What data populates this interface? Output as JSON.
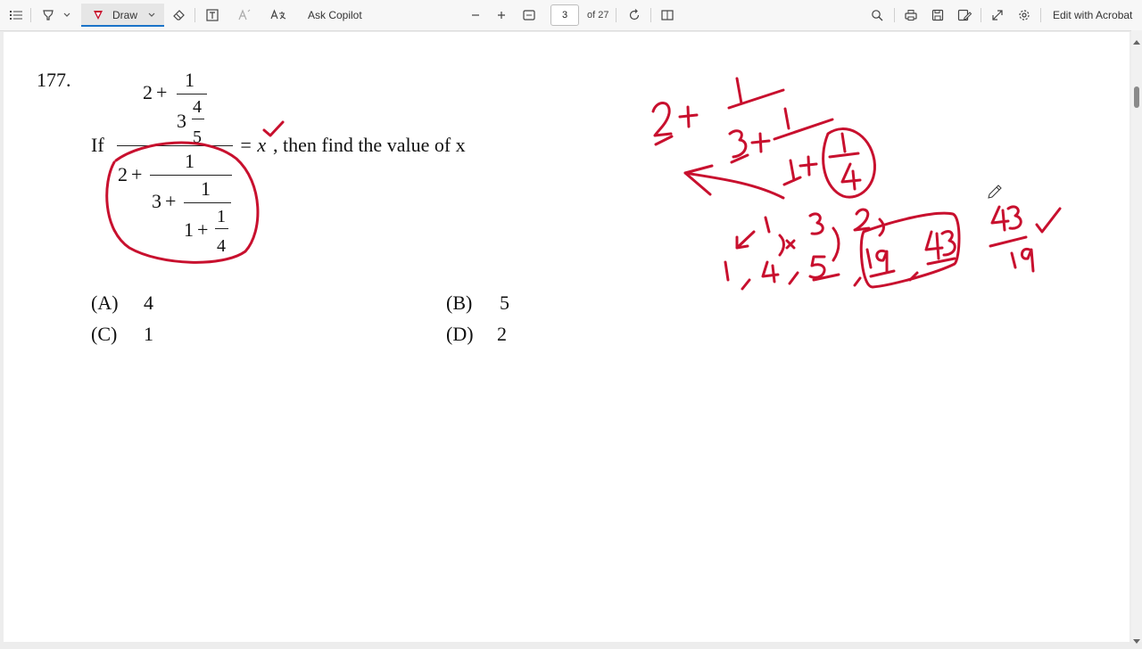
{
  "toolbar": {
    "draw_label": "Draw",
    "ask_copilot_label": "Ask Copilot",
    "page_current": "3",
    "page_total": "of 27",
    "edit_label": "Edit with Acrobat"
  },
  "question": {
    "number": "177.",
    "prefix": "If",
    "num_two": "2",
    "num_plus": "+",
    "num_one": "1",
    "num_three": "3",
    "num_four": "4",
    "num_five": "5",
    "eq": "= x",
    "suffix": ", then find the value of x",
    "den_two": "2",
    "den_plus": "+",
    "den_one": "1",
    "den_three": "3",
    "den_plus2": "+",
    "den_one2": "1",
    "den_one3": "1",
    "den_plus3": "+",
    "den_one4": "1",
    "den_four": "4"
  },
  "options": {
    "a_label": "(A)",
    "a_value": "4",
    "b_label": "(B)",
    "b_value": "5",
    "c_label": "(C)",
    "c_value": "1",
    "d_label": "(D)",
    "d_value": "2"
  },
  "ink_color": "#c8102e",
  "accent_color": "#1a73c8"
}
